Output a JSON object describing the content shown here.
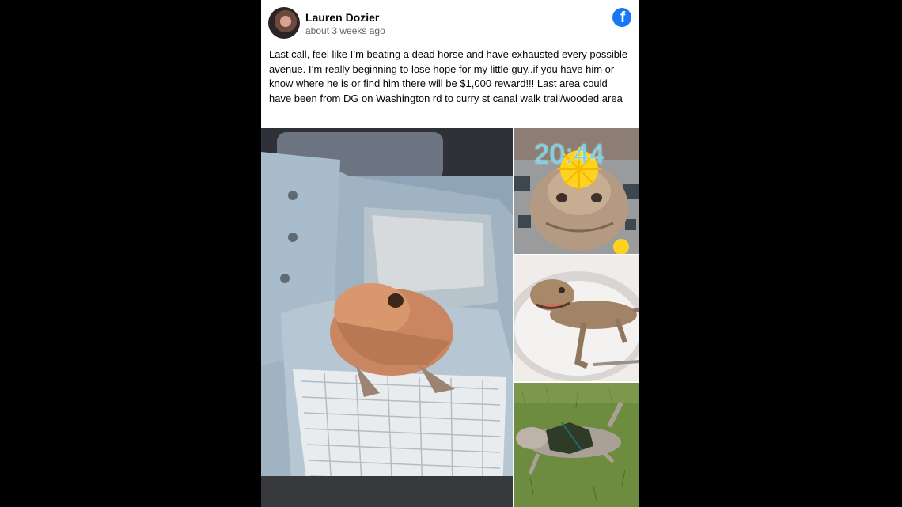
{
  "post": {
    "author": "Lauren Dozier",
    "timestamp": "about 3 weeks ago",
    "platform_icon": "facebook-icon",
    "text": "Last call, feel like I’m beating a dead horse and have exhausted every possible avenue. I’m really beginning to lose hope for my little guy..if you have him or know where he is or find him there will be $1,000 reward!!! Last area could have been from DG on Washington rd to curry st canal walk trail/wooded area"
  },
  "photos": {
    "snap_time": "20:44"
  },
  "colors": {
    "background": "#000000",
    "card": "#ffffff",
    "brand": "#1877f2",
    "secondary_text": "#65676b"
  }
}
